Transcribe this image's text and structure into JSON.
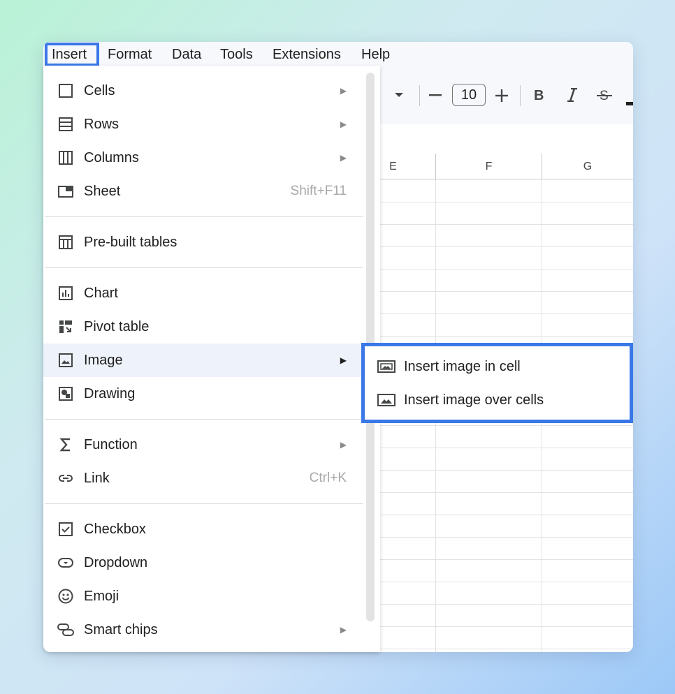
{
  "menubar": {
    "items": [
      "Insert",
      "Format",
      "Data",
      "Tools",
      "Extensions",
      "Help"
    ]
  },
  "toolbar": {
    "font_size": "10",
    "icons": [
      "dropdown-arrow-icon",
      "minus-icon",
      "plus-icon",
      "bold-icon",
      "italic-icon",
      "strikethrough-icon"
    ]
  },
  "grid": {
    "columns": [
      "E",
      "F",
      "G"
    ]
  },
  "insert_menu": {
    "items": [
      {
        "label": "Cells",
        "icon": "cell-square-icon",
        "submenu": true
      },
      {
        "label": "Rows",
        "icon": "rows-icon",
        "submenu": true
      },
      {
        "label": "Columns",
        "icon": "columns-icon",
        "submenu": true
      },
      {
        "label": "Sheet",
        "icon": "sheet-icon",
        "shortcut": "Shift+F11"
      },
      {
        "label": "Pre-built tables",
        "icon": "table-icon"
      },
      {
        "label": "Chart",
        "icon": "chart-icon"
      },
      {
        "label": "Pivot table",
        "icon": "pivot-table-icon"
      },
      {
        "label": "Image",
        "icon": "image-icon",
        "submenu": true,
        "active": true
      },
      {
        "label": "Drawing",
        "icon": "drawing-icon"
      },
      {
        "label": "Function",
        "icon": "sigma-icon",
        "submenu": true
      },
      {
        "label": "Link",
        "icon": "link-icon",
        "shortcut": "Ctrl+K"
      },
      {
        "label": "Checkbox",
        "icon": "checkbox-icon"
      },
      {
        "label": "Dropdown",
        "icon": "dropdown-icon"
      },
      {
        "label": "Emoji",
        "icon": "emoji-icon"
      },
      {
        "label": "Smart chips",
        "icon": "smart-chips-icon",
        "submenu": true
      }
    ]
  },
  "image_submenu": {
    "items": [
      {
        "label": "Insert image in cell",
        "icon": "image-in-cell-icon"
      },
      {
        "label": "Insert image over cells",
        "icon": "image-over-cells-icon"
      }
    ]
  },
  "colors": {
    "highlight": "#3a78e7",
    "active_row": "#eef2fa",
    "chrome": "#f6f8fc"
  }
}
